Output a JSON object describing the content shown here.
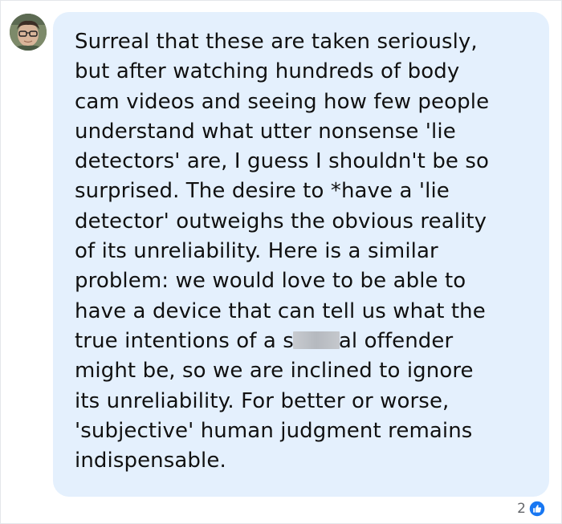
{
  "comment": {
    "avatar": "user-avatar-photo",
    "lines": [
      "Surreal that these are taken seriously,",
      "but after watching hundreds of body",
      "cam videos and seeing how few people",
      "understand what utter nonsense 'lie",
      "detectors' are, I guess I shouldn't be so",
      "surprised. The desire to *have a 'lie",
      "detector' outweighs the obvious reality",
      "of its unreliability. Here is a similar",
      "problem: we would love to be able to",
      "have a device that can tell us what the",
      "might be, so we are inclined to ignore",
      "its unreliability. For better or worse,",
      "'subjective' human judgment remains",
      "indispensable."
    ],
    "censored_line": {
      "before": "true intentions of a s",
      "after": "al offender"
    }
  },
  "reactions": {
    "count": "2",
    "icon": "like-icon",
    "icon_color": "#1877f2"
  },
  "colors": {
    "bubble": "#e4f0fd",
    "text": "#111111"
  }
}
